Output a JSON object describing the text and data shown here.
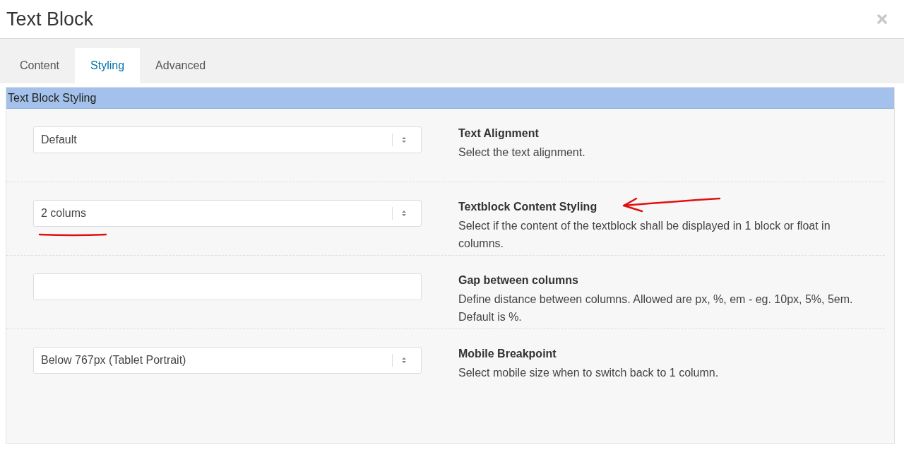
{
  "window": {
    "title": "Text Block"
  },
  "tabs": [
    {
      "label": "Content",
      "selected": false
    },
    {
      "label": "Styling",
      "selected": true
    },
    {
      "label": "Advanced",
      "selected": false
    }
  ],
  "panel": {
    "title": "Text Block Styling",
    "rows": [
      {
        "kind": "select",
        "value": "Default",
        "label": "Text Alignment",
        "description": "Select the text alignment."
      },
      {
        "kind": "select",
        "value": "2 colums",
        "label": "Textblock Content Styling",
        "description": "Select if the content of the textblock shall be displayed in 1 block or float in columns."
      },
      {
        "kind": "input",
        "value": "",
        "label": "Gap between columns",
        "description": "Define distance between columns. Allowed are px, %, em - eg. 10px, 5%, 5em. Default is %."
      },
      {
        "kind": "select",
        "value": "Below 767px (Tablet Portrait)",
        "label": "Mobile Breakpoint",
        "description": "Select mobile size when to switch back to 1 column."
      }
    ]
  }
}
